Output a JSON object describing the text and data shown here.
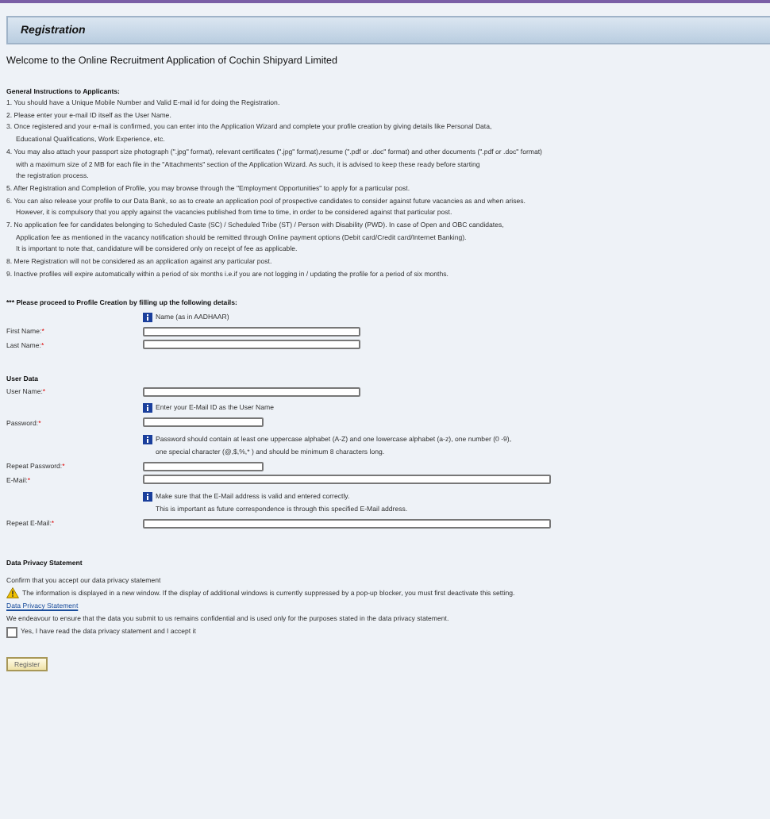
{
  "header": {
    "title": "Registration"
  },
  "welcome": "Welcome to the Online Recruitment Application of Cochin Shipyard Limited",
  "instructions": {
    "heading": "General Instructions to Applicants:",
    "items": [
      {
        "lines": [
          "1. You should have a Unique Mobile Number and Valid E-mail id for doing the Registration."
        ]
      },
      {
        "lines": [
          "2. Please enter your e-mail ID itself as the User Name."
        ]
      },
      {
        "lines": [
          "3. Once registered and your e-mail is confirmed, you can enter into the Application Wizard and complete your profile creation by giving details like Personal Data,",
          "Educational Qualifications, Work Experience, etc."
        ]
      },
      {
        "lines": [
          "4. You may also attach your passport size photograph (\".jpg\" format), relevant certificates (\".jpg\" format),resume (\".pdf or .doc\" format) and other documents (\".pdf or .doc\" format)",
          "with a maximum size of 2 MB for each file in the \"Attachments\" section of the Application Wizard. As such, it is advised to keep these ready before starting",
          "the registration process."
        ]
      },
      {
        "lines": [
          "5. After Registration and Completion of Profile, you may browse through the \"Employment Opportunities\" to apply for a particular post."
        ]
      },
      {
        "lines": [
          "6. You can also release your profile to our Data Bank, so as to create an application pool of prospective candidates to consider against future vacancies as and when arises.",
          "However, it is compulsory that you apply against the vacancies published from time to time, in order to be considered against that particular post."
        ]
      },
      {
        "lines": [
          "7. No application fee for candidates belonging to Scheduled Caste (SC) / Scheduled Tribe (ST) / Person with Disability (PWD). In case of Open and OBC candidates,",
          "Application fee as mentioned in the vacancy notification should be remitted through Online payment options (Debit card/Credit card/Internet Banking).",
          "It is important to note that, candidature will be considered only on receipt of fee as applicable."
        ]
      },
      {
        "lines": [
          "8. Mere Registration will not be considered as an application against any particular post."
        ]
      },
      {
        "lines": [
          "9. Inactive profiles will expire automatically within a period of six months i.e.if you are not logging in / updating the profile for a period of six months."
        ]
      }
    ]
  },
  "proceed": "*** Please proceed to Profile Creation by filling up the following details:",
  "sections": [
    {
      "top_hint": [
        "Name (as in AADHAAR)"
      ],
      "fields": [
        {
          "label": "First Name:",
          "required_mark": "*",
          "kind": "medium"
        },
        {
          "label": "Last Name:",
          "required_mark": "*",
          "kind": "medium"
        }
      ]
    },
    {
      "heading": "User Data",
      "fields": [
        {
          "label": "User Name:",
          "required_mark": "*",
          "kind": "medium",
          "hint": [
            "Enter your E-Mail ID as the User Name"
          ]
        },
        {
          "label": "Password:",
          "required_mark": "*",
          "kind": "short",
          "hint": [
            "Password should contain at least one uppercase alphabet (A-Z) and one lowercase alphabet (a-z), one number (0 -9),",
            "one special character (@,$,%,* ) and should be minimum 8 characters long."
          ]
        },
        {
          "label": "Repeat Password:",
          "required_mark": "*",
          "kind": "short"
        },
        {
          "label": "E-Mail:",
          "required_mark": "*",
          "kind": "long",
          "hint": [
            "Make sure that the E-Mail address is valid and entered correctly.",
            "This is important as future correspondence is through this specified E-Mail address."
          ]
        },
        {
          "label": "Repeat E-Mail:",
          "required_mark": "*",
          "kind": "long"
        }
      ]
    }
  ],
  "privacy": {
    "heading": "Data Privacy Statement",
    "confirm": "Confirm that you accept our data privacy statement",
    "warning": "The information is displayed in a new window. If the display of additional windows is currently suppressed by a pop-up blocker, you must first deactivate this setting.",
    "link": "Data Privacy Statement",
    "note": "We endeavour to ensure that the data you submit to us remains confidential and is used only for the purposes stated in the data privacy statement.",
    "accept": {
      "label": "Yes, I have read the data privacy statement and I accept it",
      "checked": false
    }
  },
  "submit": "Register"
}
